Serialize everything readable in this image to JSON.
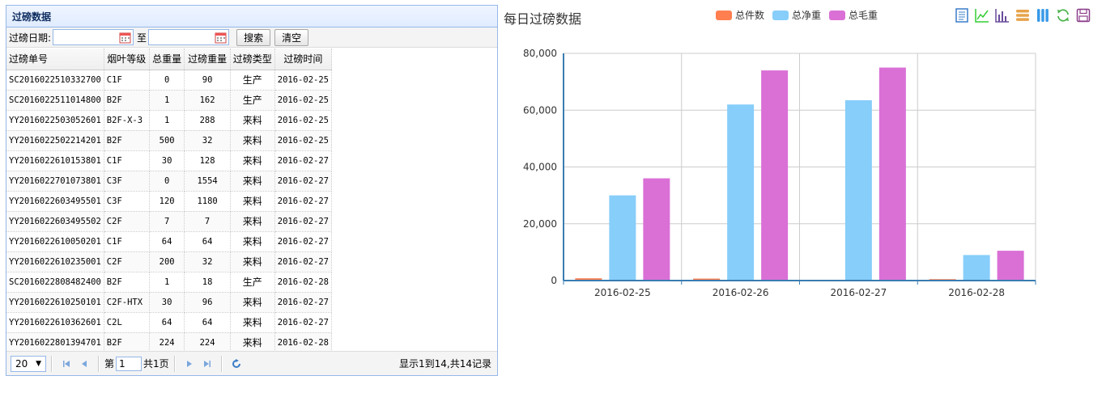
{
  "panel": {
    "title": "过磅数据"
  },
  "filter": {
    "date_label": "过磅日期:",
    "to_label": "至",
    "start_value": "",
    "end_value": "",
    "search_label": "搜索",
    "clear_label": "清空"
  },
  "table": {
    "headers": [
      "过磅单号",
      "烟叶等级",
      "总重量",
      "过磅重量",
      "过磅类型",
      "过磅时间"
    ],
    "rows": [
      [
        "SC2016022510332700",
        "C1F",
        "0",
        "90",
        "生产",
        "2016-02-25"
      ],
      [
        "SC2016022511014800",
        "B2F",
        "1",
        "162",
        "生产",
        "2016-02-25"
      ],
      [
        "YY2016022503052601",
        "B2F-X-3",
        "1",
        "288",
        "来料",
        "2016-02-25"
      ],
      [
        "YY2016022502214201",
        "B2F",
        "500",
        "32",
        "来料",
        "2016-02-25"
      ],
      [
        "YY2016022610153801",
        "C1F",
        "30",
        "128",
        "来料",
        "2016-02-27"
      ],
      [
        "YY2016022701073801",
        "C3F",
        "0",
        "1554",
        "来料",
        "2016-02-27"
      ],
      [
        "YY2016022603495501",
        "C3F",
        "120",
        "1180",
        "来料",
        "2016-02-27"
      ],
      [
        "YY2016022603495502",
        "C2F",
        "7",
        "7",
        "来料",
        "2016-02-27"
      ],
      [
        "YY2016022610050201",
        "C1F",
        "64",
        "64",
        "来料",
        "2016-02-27"
      ],
      [
        "YY2016022610235001",
        "C2F",
        "200",
        "32",
        "来料",
        "2016-02-27"
      ],
      [
        "SC2016022808482400",
        "B2F",
        "1",
        "18",
        "生产",
        "2016-02-28"
      ],
      [
        "YY2016022610250101",
        "C2F-HTX",
        "30",
        "96",
        "来料",
        "2016-02-27"
      ],
      [
        "YY2016022610362601",
        "C2L",
        "64",
        "64",
        "来料",
        "2016-02-27"
      ],
      [
        "YY2016022801394701",
        "B2F",
        "224",
        "224",
        "来料",
        "2016-02-28"
      ]
    ]
  },
  "pager": {
    "page_size": "20",
    "page_prefix": "第",
    "page_value": "1",
    "page_suffix": "共1页",
    "info": "显示1到14,共14记录"
  },
  "chart_data": {
    "type": "bar",
    "title": "每日过磅数据",
    "categories": [
      "2016-02-25",
      "2016-02-26",
      "2016-02-27",
      "2016-02-28"
    ],
    "series": [
      {
        "name": "总件数",
        "color": "#ff7f50",
        "values": [
          800,
          700,
          0,
          500
        ]
      },
      {
        "name": "总净重",
        "color": "#87cefa",
        "values": [
          30000,
          62000,
          63500,
          9000
        ]
      },
      {
        "name": "总毛重",
        "color": "#da70d6",
        "values": [
          36000,
          74000,
          75000,
          10500
        ]
      }
    ],
    "ylim": [
      0,
      80000
    ],
    "yticks": [
      "0",
      "20,000",
      "40,000",
      "60,000",
      "80,000"
    ],
    "ytick_values": [
      0,
      20000,
      40000,
      60000,
      80000
    ],
    "grid": true,
    "legend": "top"
  },
  "toolbox": [
    "data-view-icon",
    "line-chart-icon",
    "bar-chart-icon",
    "stack-icon",
    "tiled-icon",
    "restore-icon",
    "save-image-icon"
  ],
  "colors": {
    "panel_border": "#95b8e7",
    "header_text": "#0e2d5f",
    "axis": "#3a7cb1"
  }
}
